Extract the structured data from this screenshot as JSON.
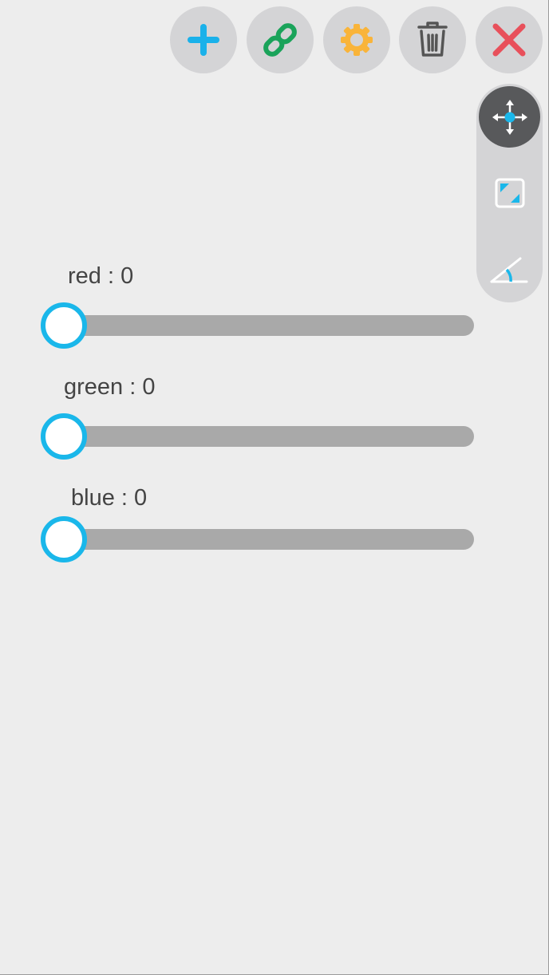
{
  "toolbar": {
    "buttons": [
      {
        "icon": "plus-icon",
        "color": "#1ab1ea"
      },
      {
        "icon": "link-icon",
        "color": "#1aa35a"
      },
      {
        "icon": "gear-icon",
        "color": "#f9b43a"
      },
      {
        "icon": "trash-icon",
        "color": "#555555"
      },
      {
        "icon": "close-icon",
        "color": "#e8505b"
      }
    ]
  },
  "side_panel": {
    "tools": [
      {
        "icon": "move-arrows-icon",
        "active": true
      },
      {
        "icon": "resize-icon",
        "active": false
      },
      {
        "icon": "angle-icon",
        "active": false
      }
    ]
  },
  "sliders": [
    {
      "name": "red",
      "label": "red : 0",
      "value": 0,
      "min": 0,
      "max": 255
    },
    {
      "name": "green",
      "label": "green : 0",
      "value": 0,
      "min": 0,
      "max": 255
    },
    {
      "name": "blue",
      "label": "blue : 0",
      "value": 0,
      "min": 0,
      "max": 255
    }
  ],
  "colors": {
    "accent": "#1ab7ea",
    "track": "#a9a9a9",
    "button_bg": "#d4d4d6",
    "active_tool_bg": "#58595b",
    "background": "#ededed"
  }
}
